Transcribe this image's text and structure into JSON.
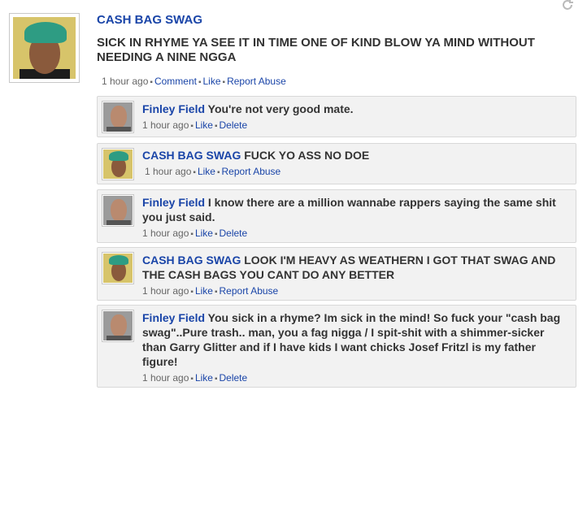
{
  "post": {
    "author": "CASH BAG SWAG",
    "text": "SICK IN RHYME YA SEE IT IN TIME ONE OF KIND BLOW YA MIND WITHOUT NEEDING A NINE NGGA",
    "time": "1 hour ago",
    "actions": {
      "comment": "Comment",
      "like": "Like",
      "report": "Report Abuse"
    }
  },
  "comments": [
    {
      "author": "Finley Field",
      "text": "You're not very good mate.",
      "time": "1 hour ago",
      "like": "Like",
      "action": "Delete"
    },
    {
      "author": "CASH BAG SWAG",
      "text": "FUCK YO ASS NO DOE",
      "time": "1 hour ago",
      "like": "Like",
      "action": "Report Abuse"
    },
    {
      "author": "Finley Field",
      "text": "I know there are a million wannabe rappers saying the same shit you just said.",
      "time": "1 hour ago",
      "like": "Like",
      "action": "Delete"
    },
    {
      "author": "CASH BAG SWAG",
      "text": "LOOK I'M HEAVY AS WEATHERN I GOT THAT SWAG AND THE CASH BAGS YOU CANT DO ANY BETTER",
      "time": "1 hour ago",
      "like": "Like",
      "action": "Report Abuse"
    },
    {
      "author": "Finley Field",
      "text": "You sick in a rhyme? Im sick in the mind! So fuck your \"cash bag swag\"..Pure trash.. man, you a fag nigga / I spit-shit with a shimmer-sicker than Garry Glitter and if I have kids I want chicks Josef Fritzl is my father figure!",
      "time": "1 hour ago",
      "like": "Like",
      "action": "Delete"
    }
  ],
  "icons": {
    "refresh": "refresh-icon",
    "separator": "•"
  }
}
